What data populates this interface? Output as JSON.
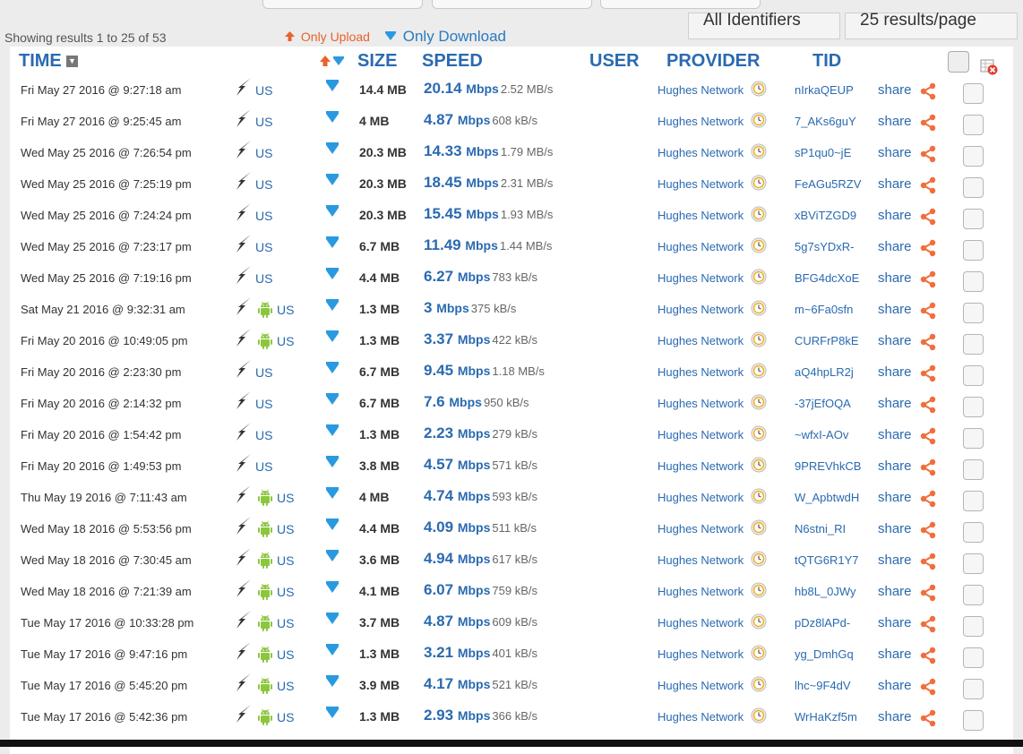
{
  "filters": {
    "showing_text": "Showing results 1 to 25 of 53",
    "only_upload": "Only Upload",
    "only_download": "Only Download",
    "identifiers": "All Identifiers",
    "per_page": "25 results/page"
  },
  "columns": {
    "time": "TIME",
    "size": "SIZE",
    "speed": "SPEED",
    "user": "USER",
    "provider": "PROVIDER",
    "tid": "TID"
  },
  "colors": {
    "accent": "#2a6ab0",
    "upload": "#e8622b",
    "download": "#2a9ae0",
    "android": "#8cc63f"
  },
  "rows": [
    {
      "time": "Fri May 27 2016 @ 9:27:18 am",
      "android": false,
      "country": "US",
      "size": "14.4 MB",
      "speed": "20.14",
      "speed_unit": "Mbps",
      "mbs": "2.52 MB/s",
      "provider": "Hughes Network",
      "tid": "nIrkaQEUP",
      "share": "share"
    },
    {
      "time": "Fri May 27 2016 @ 9:25:45 am",
      "android": false,
      "country": "US",
      "size": "4 MB",
      "speed": "4.87",
      "speed_unit": "Mbps",
      "mbs": "608 kB/s",
      "provider": "Hughes Network",
      "tid": "7_AKs6guY",
      "share": "share"
    },
    {
      "time": "Wed May 25 2016 @ 7:26:54 pm",
      "android": false,
      "country": "US",
      "size": "20.3 MB",
      "speed": "14.33",
      "speed_unit": "Mbps",
      "mbs": "1.79 MB/s",
      "provider": "Hughes Network",
      "tid": "sP1qu0~jE",
      "share": "share"
    },
    {
      "time": "Wed May 25 2016 @ 7:25:19 pm",
      "android": false,
      "country": "US",
      "size": "20.3 MB",
      "speed": "18.45",
      "speed_unit": "Mbps",
      "mbs": "2.31 MB/s",
      "provider": "Hughes Network",
      "tid": "FeAGu5RZV",
      "share": "share"
    },
    {
      "time": "Wed May 25 2016 @ 7:24:24 pm",
      "android": false,
      "country": "US",
      "size": "20.3 MB",
      "speed": "15.45",
      "speed_unit": "Mbps",
      "mbs": "1.93 MB/s",
      "provider": "Hughes Network",
      "tid": "xBViTZGD9",
      "share": "share"
    },
    {
      "time": "Wed May 25 2016 @ 7:23:17 pm",
      "android": false,
      "country": "US",
      "size": "6.7 MB",
      "speed": "11.49",
      "speed_unit": "Mbps",
      "mbs": "1.44 MB/s",
      "provider": "Hughes Network",
      "tid": "5g7sYDxR-",
      "share": "share"
    },
    {
      "time": "Wed May 25 2016 @ 7:19:16 pm",
      "android": false,
      "country": "US",
      "size": "4.4 MB",
      "speed": "6.27",
      "speed_unit": "Mbps",
      "mbs": "783 kB/s",
      "provider": "Hughes Network",
      "tid": "BFG4dcXoE",
      "share": "share"
    },
    {
      "time": "Sat May 21 2016 @ 9:32:31 am",
      "android": true,
      "country": "US",
      "size": "1.3 MB",
      "speed": "3",
      "speed_unit": "Mbps",
      "mbs": "375 kB/s",
      "provider": "Hughes Network",
      "tid": "m~6Fa0sfn",
      "share": "share"
    },
    {
      "time": "Fri May 20 2016 @ 10:49:05 pm",
      "android": true,
      "country": "US",
      "size": "1.3 MB",
      "speed": "3.37",
      "speed_unit": "Mbps",
      "mbs": "422 kB/s",
      "provider": "Hughes Network",
      "tid": "CURFrP8kE",
      "share": "share"
    },
    {
      "time": "Fri May 20 2016 @ 2:23:30 pm",
      "android": false,
      "country": "US",
      "size": "6.7 MB",
      "speed": "9.45",
      "speed_unit": "Mbps",
      "mbs": "1.18 MB/s",
      "provider": "Hughes Network",
      "tid": "aQ4hpLR2j",
      "share": "share"
    },
    {
      "time": "Fri May 20 2016 @ 2:14:32 pm",
      "android": false,
      "country": "US",
      "size": "6.7 MB",
      "speed": "7.6",
      "speed_unit": "Mbps",
      "mbs": "950 kB/s",
      "provider": "Hughes Network",
      "tid": "-37jEfOQA",
      "share": "share"
    },
    {
      "time": "Fri May 20 2016 @ 1:54:42 pm",
      "android": false,
      "country": "US",
      "size": "1.3 MB",
      "speed": "2.23",
      "speed_unit": "Mbps",
      "mbs": "279 kB/s",
      "provider": "Hughes Network",
      "tid": "~wfxI-AOv",
      "share": "share"
    },
    {
      "time": "Fri May 20 2016 @ 1:49:53 pm",
      "android": false,
      "country": "US",
      "size": "3.8 MB",
      "speed": "4.57",
      "speed_unit": "Mbps",
      "mbs": "571 kB/s",
      "provider": "Hughes Network",
      "tid": "9PREVhkCB",
      "share": "share"
    },
    {
      "time": "Thu May 19 2016 @ 7:11:43 am",
      "android": true,
      "country": "US",
      "size": "4 MB",
      "speed": "4.74",
      "speed_unit": "Mbps",
      "mbs": "593 kB/s",
      "provider": "Hughes Network",
      "tid": "W_ApbtwdH",
      "share": "share"
    },
    {
      "time": "Wed May 18 2016 @ 5:53:56 pm",
      "android": true,
      "country": "US",
      "size": "4.4 MB",
      "speed": "4.09",
      "speed_unit": "Mbps",
      "mbs": "511 kB/s",
      "provider": "Hughes Network",
      "tid": "N6stni_RI",
      "share": "share"
    },
    {
      "time": "Wed May 18 2016 @ 7:30:45 am",
      "android": true,
      "country": "US",
      "size": "3.6 MB",
      "speed": "4.94",
      "speed_unit": "Mbps",
      "mbs": "617 kB/s",
      "provider": "Hughes Network",
      "tid": "tQTG6R1Y7",
      "share": "share"
    },
    {
      "time": "Wed May 18 2016 @ 7:21:39 am",
      "android": true,
      "country": "US",
      "size": "4.1 MB",
      "speed": "6.07",
      "speed_unit": "Mbps",
      "mbs": "759 kB/s",
      "provider": "Hughes Network",
      "tid": "hb8L_0JWy",
      "share": "share"
    },
    {
      "time": "Tue May 17 2016 @ 10:33:28 pm",
      "android": true,
      "country": "US",
      "size": "3.7 MB",
      "speed": "4.87",
      "speed_unit": "Mbps",
      "mbs": "609 kB/s",
      "provider": "Hughes Network",
      "tid": "pDz8lAPd-",
      "share": "share"
    },
    {
      "time": "Tue May 17 2016 @ 9:47:16 pm",
      "android": true,
      "country": "US",
      "size": "1.3 MB",
      "speed": "3.21",
      "speed_unit": "Mbps",
      "mbs": "401 kB/s",
      "provider": "Hughes Network",
      "tid": "yg_DmhGq",
      "share": "share"
    },
    {
      "time": "Tue May 17 2016 @ 5:45:20 pm",
      "android": true,
      "country": "US",
      "size": "3.9 MB",
      "speed": "4.17",
      "speed_unit": "Mbps",
      "mbs": "521 kB/s",
      "provider": "Hughes Network",
      "tid": "lhc~9F4dV",
      "share": "share"
    },
    {
      "time": "Tue May 17 2016 @ 5:42:36 pm",
      "android": true,
      "country": "US",
      "size": "1.3 MB",
      "speed": "2.93",
      "speed_unit": "Mbps",
      "mbs": "366 kB/s",
      "provider": "Hughes Network",
      "tid": "WrHaKzf5m",
      "share": "share"
    }
  ]
}
